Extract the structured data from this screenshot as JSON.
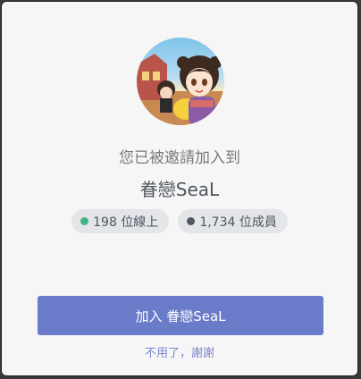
{
  "invite": {
    "subtitle": "您已被邀請加入到",
    "server_name": "眷戀SeaL",
    "online_count": "198 位線上",
    "member_count": "1,734 位成員",
    "join_label": "加入 眷戀SeaL",
    "decline_label": "不用了，謝謝"
  },
  "colors": {
    "online_dot": "#43b581",
    "members_dot": "#4f5660",
    "button": "#6a7bc9",
    "link": "#7b86cc"
  },
  "icons": {
    "avatar": "server-icon-anime-characters"
  }
}
